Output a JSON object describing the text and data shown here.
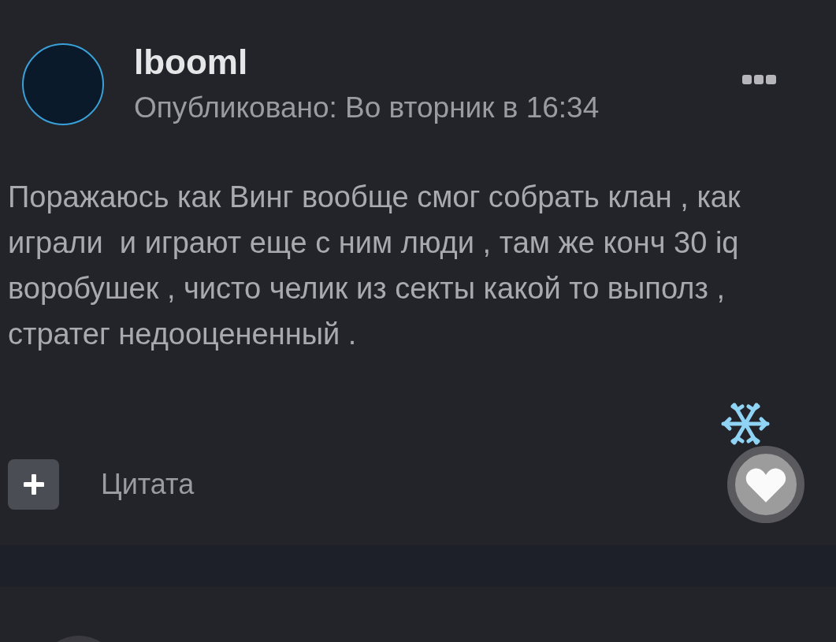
{
  "post": {
    "author": "lbooml",
    "published": "Опубликовано: Во вторник в 16:34",
    "body": "Поражаюсь как Винг вообще смог собрать клан , как играли  и играют еще с ним люди , там же конч 30 iq воробушек , чисто челик из секты какой то выполз , стратег недооцененный .",
    "quote_label": "Цитата"
  }
}
